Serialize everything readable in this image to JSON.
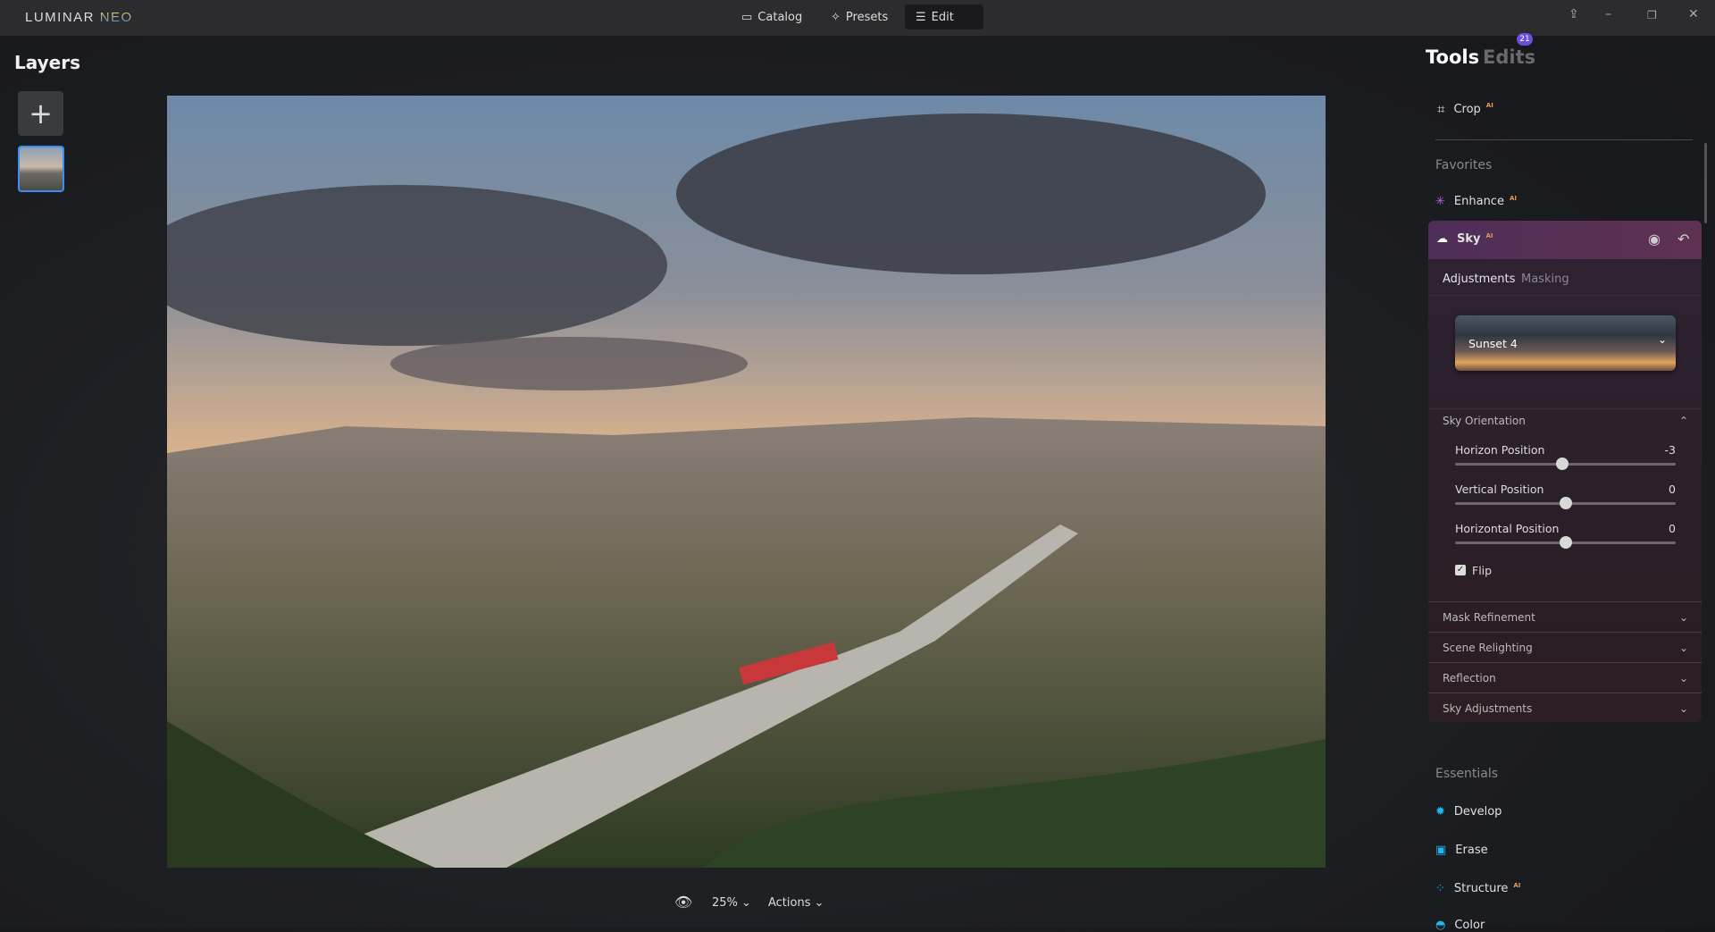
{
  "app": {
    "logo_main": "LUMINAR",
    "logo_accent": "NEO"
  },
  "nav": {
    "catalog": "Catalog",
    "presets": "Presets",
    "edit": "Edit"
  },
  "layers": {
    "title": "Layers",
    "add": "+"
  },
  "bottom": {
    "zoom": "25%",
    "actions": "Actions"
  },
  "panel": {
    "tools": "Tools",
    "edits": "Edits",
    "edits_badge": "21",
    "ai": "AI",
    "crop": "Crop",
    "favorites": "Favorites",
    "enhance": "Enhance",
    "sky": "Sky",
    "tabs": [
      "Adjustments",
      "Masking"
    ],
    "sky_preset": "Sunset 4",
    "orientation": "Sky Orientation",
    "sliders": [
      {
        "label": "Horizon Position",
        "value": "-3",
        "fraction": 0.485
      },
      {
        "label": "Vertical Position",
        "value": "0",
        "fraction": 0.5
      },
      {
        "label": "Horizontal Position",
        "value": "0",
        "fraction": 0.5
      }
    ],
    "flip": "Flip",
    "sections": [
      "Mask Refinement",
      "Scene Relighting",
      "Reflection",
      "Sky Adjustments"
    ],
    "essentials": "Essentials",
    "essential_items": [
      "Develop",
      "Erase",
      "Structure",
      "Color"
    ]
  },
  "colors": {
    "accent": "#3d8df5",
    "sky_header": "#5e3152",
    "badge": "#6a4fd8"
  }
}
